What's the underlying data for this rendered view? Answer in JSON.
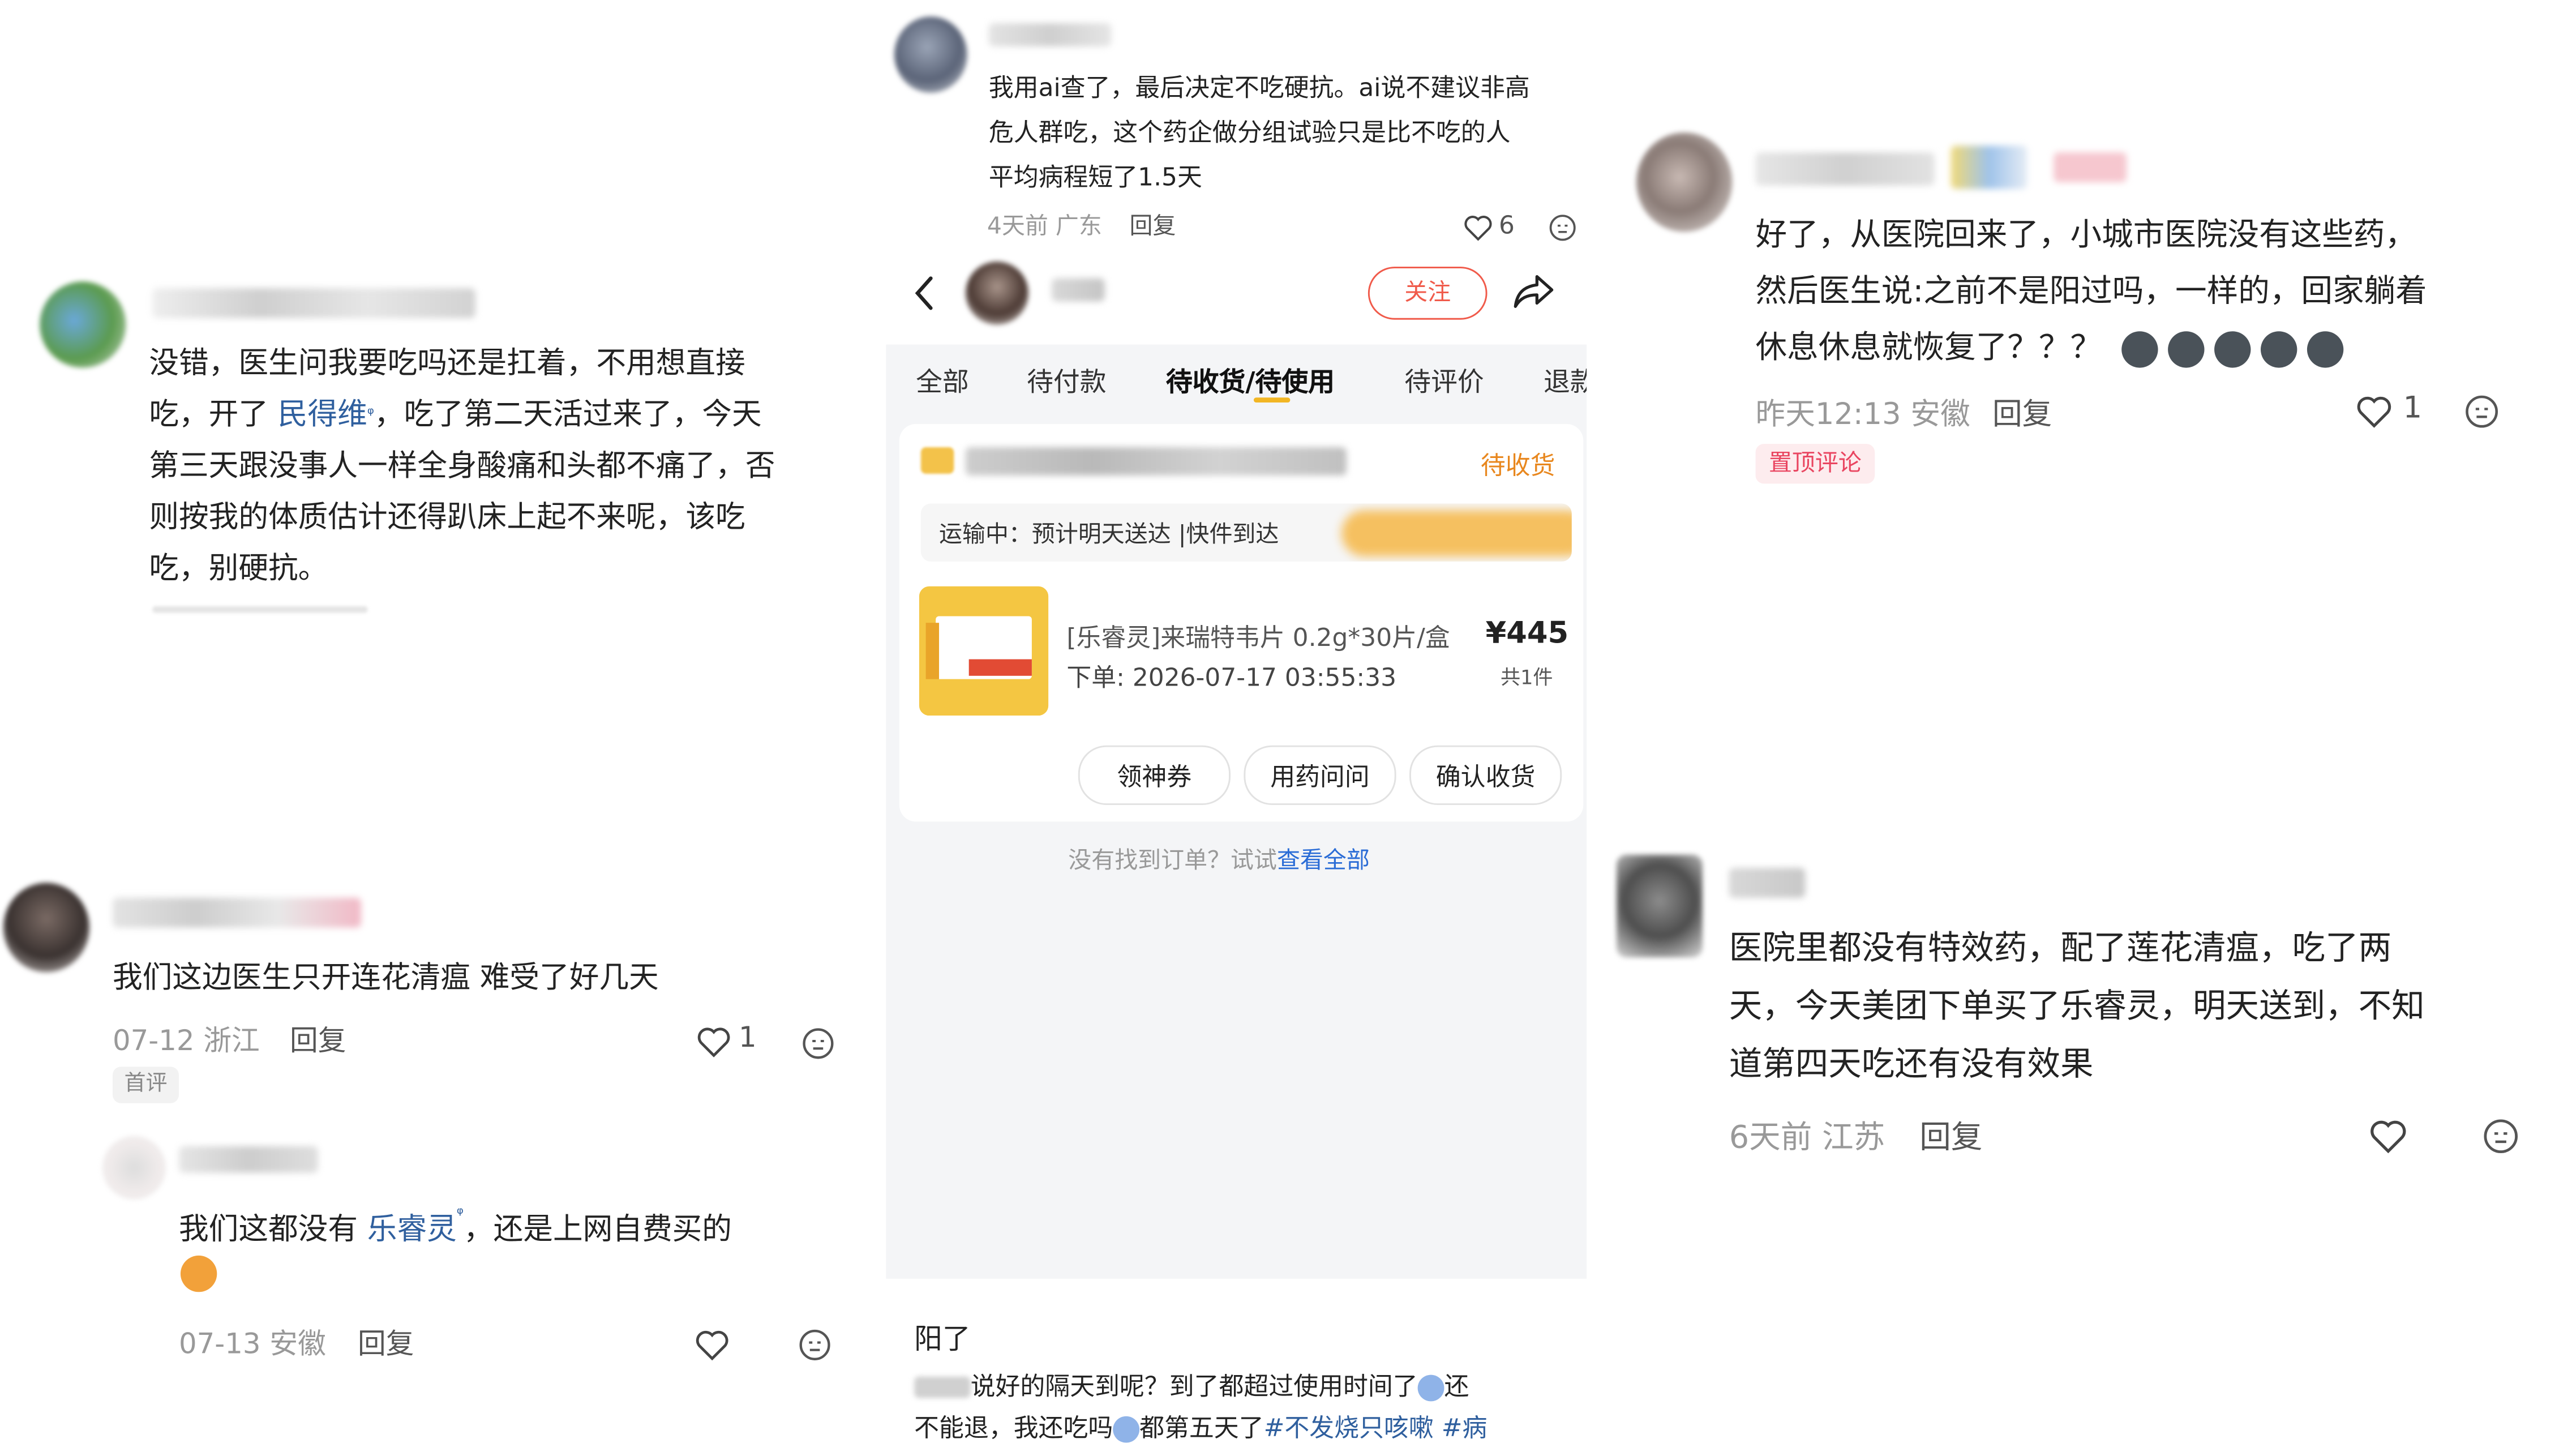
{
  "left": {
    "comment1": {
      "lines": [
        "没错，医生问我要吃吗还是扛着，不用想直接",
        "吃，开了",
        "民得维",
        "，吃了第二天活过来了，今天",
        "第三天跟没事人一样全身酸痛和头都不痛了，否",
        "则按我的体质估计还得趴床上起不来呢，该吃",
        "吃，别硬抗。"
      ]
    },
    "comment2": {
      "text": "我们这边医生只开连花清瘟 难受了好几天",
      "meta": "07-12 浙江",
      "reply": "回复",
      "likes": "1",
      "badge": "首评"
    },
    "reply1": {
      "before": "我们这都没有",
      "link": "乐睿灵",
      "after": "，还是上网自费买的",
      "meta": "07-13 安徽",
      "reply": "回复"
    }
  },
  "middle": {
    "top_comment": {
      "lines": [
        "我用ai查了，最后决定不吃硬抗。ai说不建议非高",
        "危人群吃，这个药企做分组试验只是比不吃的人",
        "平均病程短了1.5天"
      ],
      "meta": "4天前 广东",
      "reply": "回复",
      "likes": "6"
    },
    "header": {
      "follow": "关注"
    },
    "tabs": [
      "全部",
      "待付款",
      "待收货/待使用",
      "待评价",
      "退款"
    ],
    "order": {
      "status": "待收货",
      "shipping": "运输中：预计明天送达 |快件到达",
      "product": "[乐睿灵]来瑞特韦片 0.2g*30片/盒",
      "price": "¥445",
      "order_time": "下单: 2026-07-17 03:55:33",
      "qty": "共1件",
      "buttons": [
        "领神券",
        "用药问问",
        "确认收货"
      ]
    },
    "footer_prefix": "没有找到订单？试试",
    "footer_link": "查看全部",
    "post": {
      "title": "阳了",
      "line1_a": "说好的隔天到呢？到了都超过使用时间了",
      "line1_b": "还",
      "line2_a": "不能退，我还吃吗",
      "line2_b": "都第五天了",
      "line2_tags": "#不发烧只咳嗽 #病"
    }
  },
  "right": {
    "comment1": {
      "lines": [
        "好了，从医院回来了，小城市医院没有这些药，",
        "然后医生说:之前不是阳过吗，一样的，回家躺着",
        "休息休息就恢复了？？？"
      ],
      "meta": "昨天12:13 安徽",
      "reply": "回复",
      "likes": "1",
      "badge": "置顶评论"
    },
    "comment2": {
      "lines": [
        "医院里都没有特效药，配了莲花清瘟，吃了两",
        "天，今天美团下单买了乐睿灵，明天送到，不知",
        "道第四天吃还有没有效果"
      ],
      "meta": "6天前 江苏",
      "reply": "回复"
    }
  },
  "colors": {
    "link": "#2f5f9e",
    "accent": "#f05a4a",
    "orange": "#e8871e",
    "badge_red": "#e94560"
  }
}
